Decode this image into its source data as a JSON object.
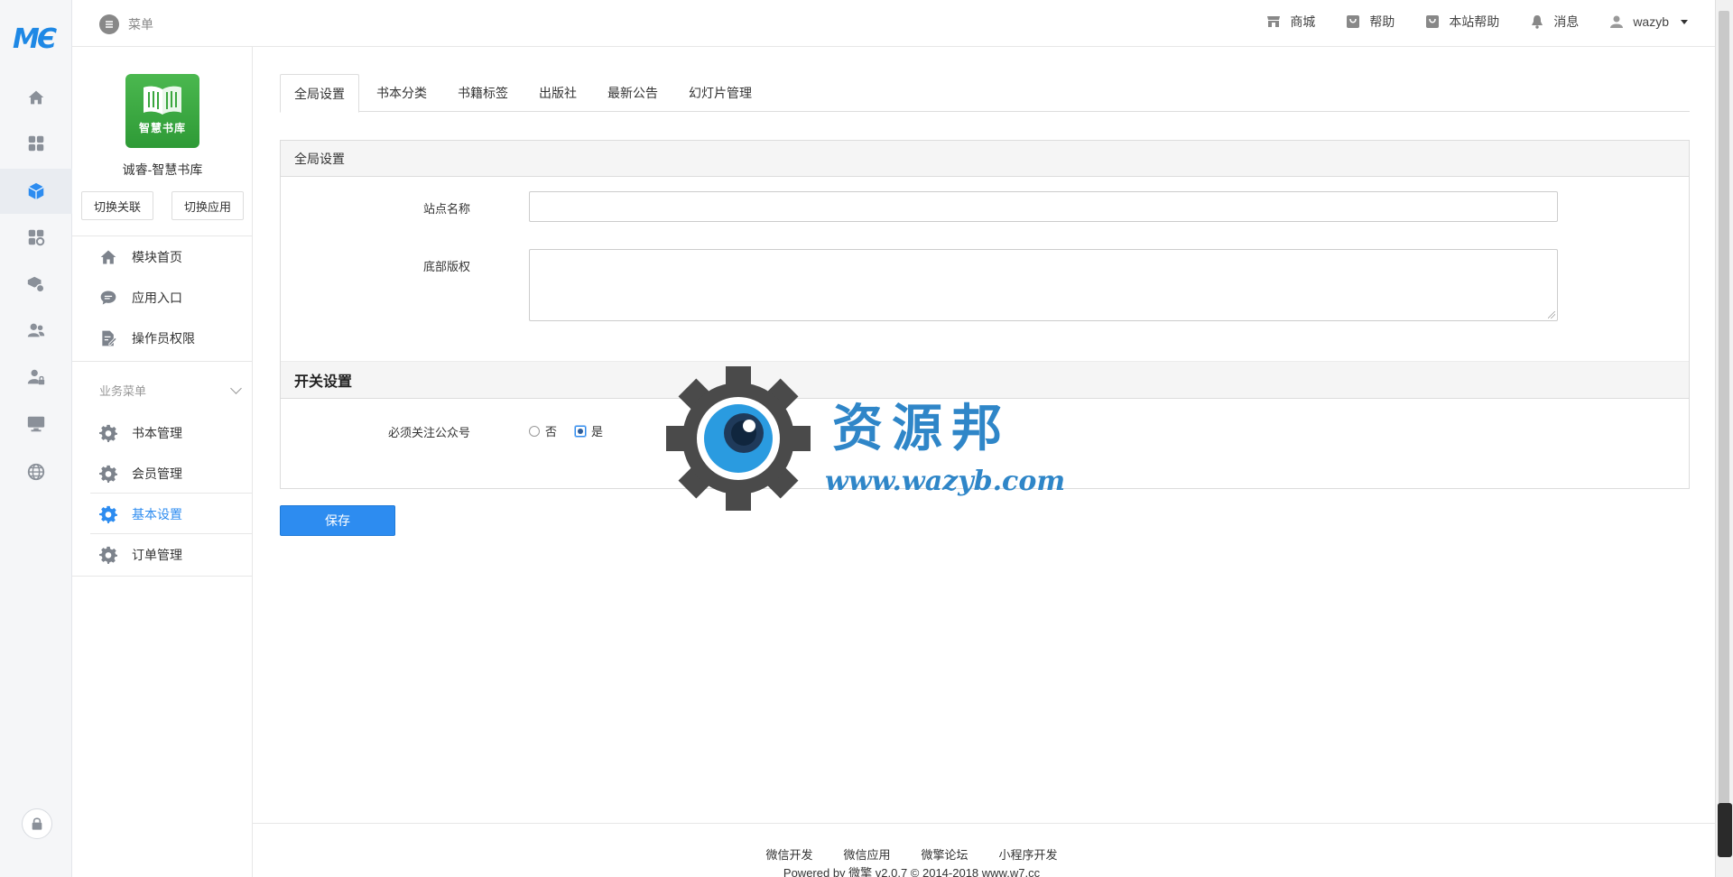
{
  "brand": {
    "logo_text": "MЄ"
  },
  "topbar": {
    "menu_label": "菜单",
    "links": [
      {
        "label": "商城",
        "icon": "store-icon"
      },
      {
        "label": "帮助",
        "icon": "help-icon"
      },
      {
        "label": "本站帮助",
        "icon": "help-icon"
      },
      {
        "label": "消息",
        "icon": "bell-icon"
      }
    ],
    "user": "wazyb"
  },
  "sidebar": {
    "app_logo_text": "智慧书库",
    "app_name": "诚睿-智慧书库",
    "switch_buttons": [
      "切换关联",
      "切换应用"
    ],
    "items": [
      {
        "label": "模块首页",
        "icon": "home-icon"
      },
      {
        "label": "应用入口",
        "icon": "chat-icon"
      },
      {
        "label": "操作员权限",
        "icon": "edit-doc-icon"
      }
    ],
    "group_label": "业务菜单",
    "group_items": [
      {
        "label": "书本管理",
        "icon": "gear-icon",
        "active": false
      },
      {
        "label": "会员管理",
        "icon": "gear-icon",
        "active": false
      },
      {
        "label": "基本设置",
        "icon": "gear-icon",
        "active": true
      },
      {
        "label": "订单管理",
        "icon": "gear-icon",
        "active": false
      }
    ]
  },
  "tabs": [
    "全局设置",
    "书本分类",
    "书籍标签",
    "出版社",
    "最新公告",
    "幻灯片管理"
  ],
  "form": {
    "panel_title": "全局设置",
    "site_name_label": "站点名称",
    "site_name_value": "",
    "copyright_label": "底部版权",
    "copyright_value": "",
    "switch_section_title": "开关设置",
    "follow_label": "必须关注公众号",
    "follow_options": [
      "否",
      "是"
    ],
    "follow_selected": "是",
    "save_label": "保存"
  },
  "watermark": {
    "title": "资源邦",
    "url": "www.wazyb.com"
  },
  "footer": {
    "links": [
      "微信开发",
      "微信应用",
      "微擎论坛",
      "小程序开发"
    ],
    "powered": "Powered by 微擎 v2.0.7 © 2014-2018 www.w7.cc"
  },
  "colors": {
    "accent": "#2d8cf0",
    "brand_green": "#3aa63e",
    "watermark": "#2f86c8"
  }
}
